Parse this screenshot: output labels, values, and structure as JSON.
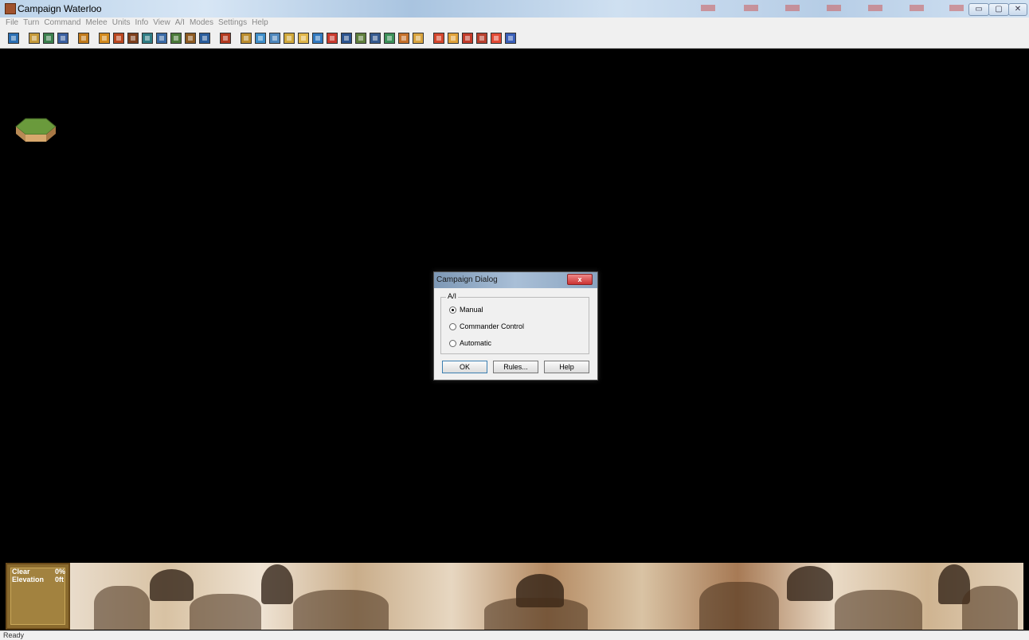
{
  "window": {
    "title": "Campaign Waterloo",
    "min_icon": "minimize-icon",
    "max_icon": "maximize-icon",
    "close_icon": "close-icon",
    "min_glyph": "▭",
    "max_glyph": "▢",
    "close_glyph": "✕"
  },
  "menu": [
    "File",
    "Turn",
    "Command",
    "Melee",
    "Units",
    "Info",
    "View",
    "A/I",
    "Modes",
    "Settings",
    "Help"
  ],
  "toolbar": {
    "colors": [
      "#2b6fb3",
      "#c59a3a",
      "#3b7f4d",
      "#3a5fa0",
      "#c07a1b",
      "#d28a1e",
      "#b9461f",
      "#7d3f1c",
      "#2f7c84",
      "#3a6aa5",
      "#4b7a3a",
      "#8c5a21",
      "#2a5d9c",
      "#b33a1f",
      "#bb8d2e",
      "#3e8ec9",
      "#4f88bd",
      "#d0a83a",
      "#e0b64a",
      "#3179bf",
      "#c93a2e",
      "#2c548f",
      "#5f7f3d",
      "#355a8f",
      "#3b8f58",
      "#c5702a",
      "#d9a43e",
      "#d4462d",
      "#e0a23a",
      "#c23b2a",
      "#b8402e",
      "#e24a35",
      "#3a5fb8"
    ]
  },
  "dialog": {
    "title": "Campaign Dialog",
    "close_label": "x",
    "group_label": "A/I",
    "options": [
      "Manual",
      "Commander Control",
      "Automatic"
    ],
    "selected": "Manual",
    "buttons": {
      "ok": "OK",
      "rules": "Rules...",
      "help": "Help"
    }
  },
  "info_panel": {
    "terrain": "Clear",
    "terrain_value": "0%",
    "elevation_label": "Elevation",
    "elevation_value": "0ft"
  },
  "status": {
    "text": "Ready"
  }
}
